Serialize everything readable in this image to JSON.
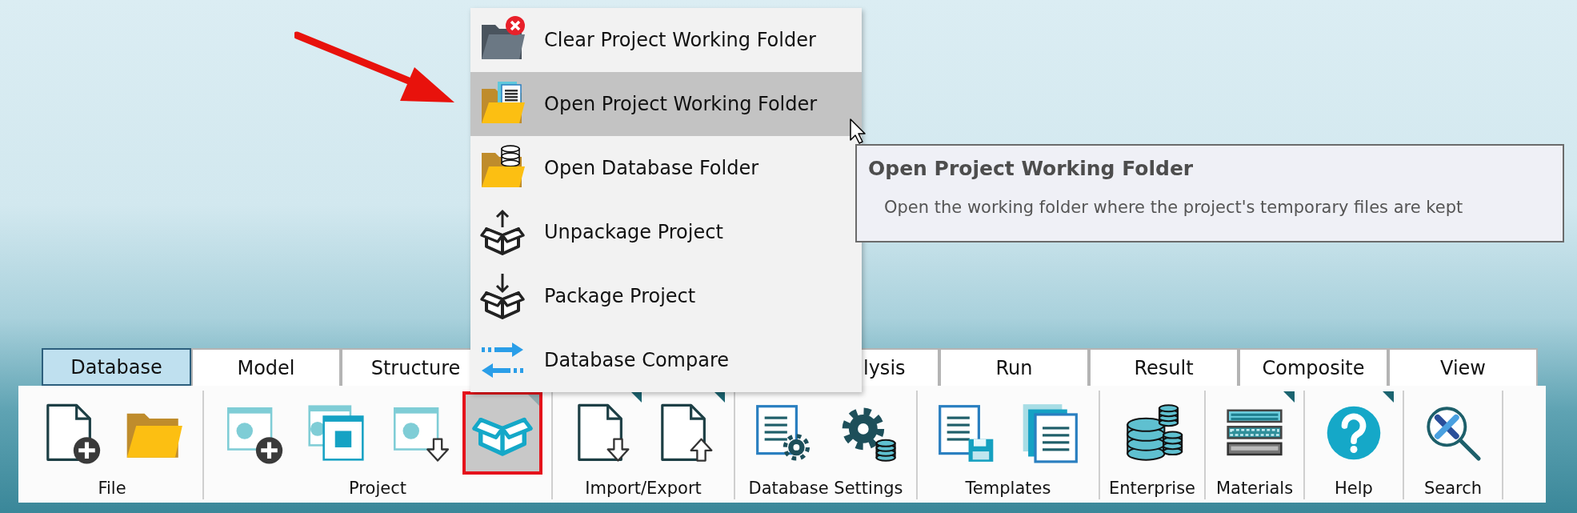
{
  "annotations": [
    {
      "kind": "arrow"
    }
  ],
  "context_menu": {
    "items": [
      {
        "label": "Clear Project Working Folder",
        "selected": false
      },
      {
        "label": "Open Project Working Folder",
        "selected": true
      },
      {
        "label": "Open Database Folder",
        "selected": false
      },
      {
        "label": "Unpackage Project",
        "selected": false
      },
      {
        "label": "Package Project",
        "selected": false
      },
      {
        "label": "Database Compare",
        "selected": false
      }
    ]
  },
  "pointer": {
    "kind": "arrow"
  },
  "tooltip": {
    "title": "Open Project Working Folder",
    "text": "Open the working folder where the project's temporary files are kept"
  },
  "tabs": [
    {
      "label": "Database",
      "selected": true,
      "covered_left": false
    },
    {
      "label": "Model",
      "selected": false,
      "covered_left": false
    },
    {
      "label": "Structure",
      "selected": false,
      "covered_left": false
    },
    {
      "label": "lysis",
      "selected": false,
      "covered_left": true
    },
    {
      "label": "Run",
      "selected": false,
      "covered_left": false
    },
    {
      "label": "Result",
      "selected": false,
      "covered_left": false
    },
    {
      "label": "Composite",
      "selected": false,
      "covered_left": false
    },
    {
      "label": "View",
      "selected": false,
      "covered_left": false
    }
  ],
  "ribbon": {
    "groups": [
      {
        "label": "File",
        "buttons": [
          {
            "selected": false,
            "highlighted": false,
            "dropdown": false
          },
          {
            "selected": false,
            "highlighted": false,
            "dropdown": false
          }
        ]
      },
      {
        "label": "Project",
        "buttons": [
          {
            "selected": false,
            "highlighted": false,
            "dropdown": false
          },
          {
            "selected": false,
            "highlighted": false,
            "dropdown": false
          },
          {
            "selected": false,
            "highlighted": false,
            "dropdown": false
          },
          {
            "selected": true,
            "highlighted": true,
            "dropdown": true
          }
        ]
      },
      {
        "label": "Import/Export",
        "buttons": [
          {
            "selected": false,
            "highlighted": false,
            "dropdown": true
          },
          {
            "selected": false,
            "highlighted": false,
            "dropdown": true
          }
        ]
      },
      {
        "label": "Database Settings",
        "buttons": [
          {
            "selected": false,
            "highlighted": false,
            "dropdown": false
          },
          {
            "selected": false,
            "highlighted": false,
            "dropdown": false
          }
        ]
      },
      {
        "label": "Templates",
        "buttons": [
          {
            "selected": false,
            "highlighted": false,
            "dropdown": false
          },
          {
            "selected": false,
            "highlighted": false,
            "dropdown": false
          }
        ]
      },
      {
        "label": "Enterprise",
        "buttons": [
          {
            "selected": false,
            "highlighted": false,
            "dropdown": false
          }
        ]
      },
      {
        "label": "Materials",
        "buttons": [
          {
            "selected": false,
            "highlighted": false,
            "dropdown": true
          }
        ]
      },
      {
        "label": "Help",
        "buttons": [
          {
            "selected": false,
            "highlighted": false,
            "dropdown": true
          }
        ]
      },
      {
        "label": "Search",
        "buttons": [
          {
            "selected": false,
            "highlighted": false,
            "dropdown": false
          }
        ]
      }
    ]
  }
}
